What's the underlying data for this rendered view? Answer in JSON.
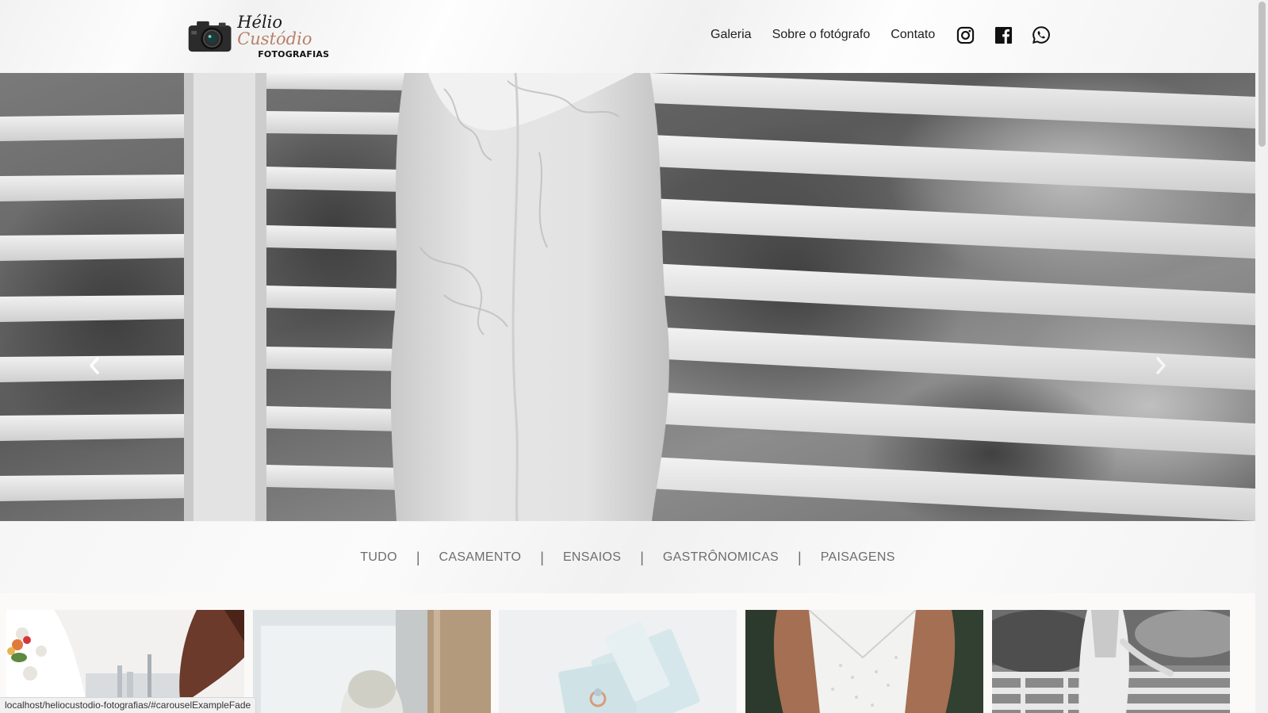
{
  "brand": {
    "name_first": "Hélio",
    "name_second": "Custódio",
    "subtitle": "FOTOGRAFIAS",
    "accent_color": "#b8806a"
  },
  "nav": {
    "items": [
      {
        "label": "Galeria"
      },
      {
        "label": "Sobre o fotógrafo"
      },
      {
        "label": "Contato"
      }
    ],
    "social": [
      {
        "icon": "instagram-icon"
      },
      {
        "icon": "facebook-icon"
      },
      {
        "icon": "whatsapp-icon"
      }
    ]
  },
  "carousel": {
    "prev_icon": "chevron-left-icon",
    "next_icon": "chevron-right-icon"
  },
  "filters": {
    "items": [
      "TUDO",
      "CASAMENTO",
      "ENSAIOS",
      "GASTRÔNOMICAS",
      "PAISAGENS"
    ],
    "separator": "|"
  },
  "gallery": {
    "thumbnails": [
      {
        "subject": "bride-with-bouquet"
      },
      {
        "subject": "bride-by-window"
      },
      {
        "subject": "rings-on-table"
      },
      {
        "subject": "bride-dress-detail"
      },
      {
        "subject": "bride-on-balcony"
      }
    ]
  },
  "status_bar": {
    "url": "localhost/heliocustodio-fotografias/#carouselExampleFade"
  }
}
